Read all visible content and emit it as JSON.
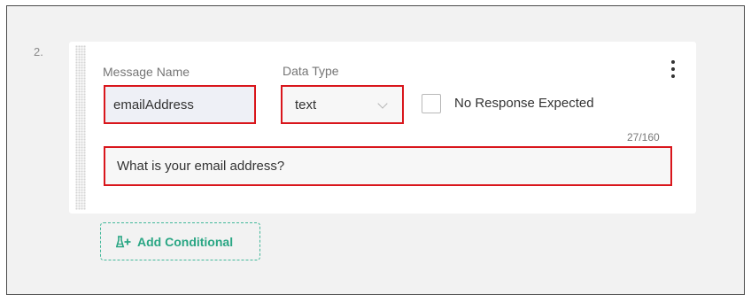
{
  "step": {
    "number": "2."
  },
  "fields": {
    "message_name_label": "Message Name",
    "message_name_value": "emailAddress",
    "data_type_label": "Data Type",
    "data_type_value": "text",
    "no_response_label": "No Response Expected",
    "no_response_checked": false,
    "char_count": "27/160",
    "message_text": "What is your email address?"
  },
  "actions": {
    "add_conditional_label": "Add Conditional"
  },
  "icons": {
    "menu": "kebab-icon",
    "dropdown": "chevron-down-icon",
    "add_conditional": "flask-plus-icon",
    "drag": "drag-handle-icon"
  },
  "colors": {
    "highlight_border": "#d9161c",
    "accent": "#2aa684",
    "frame_bg": "#f2f2f2"
  }
}
